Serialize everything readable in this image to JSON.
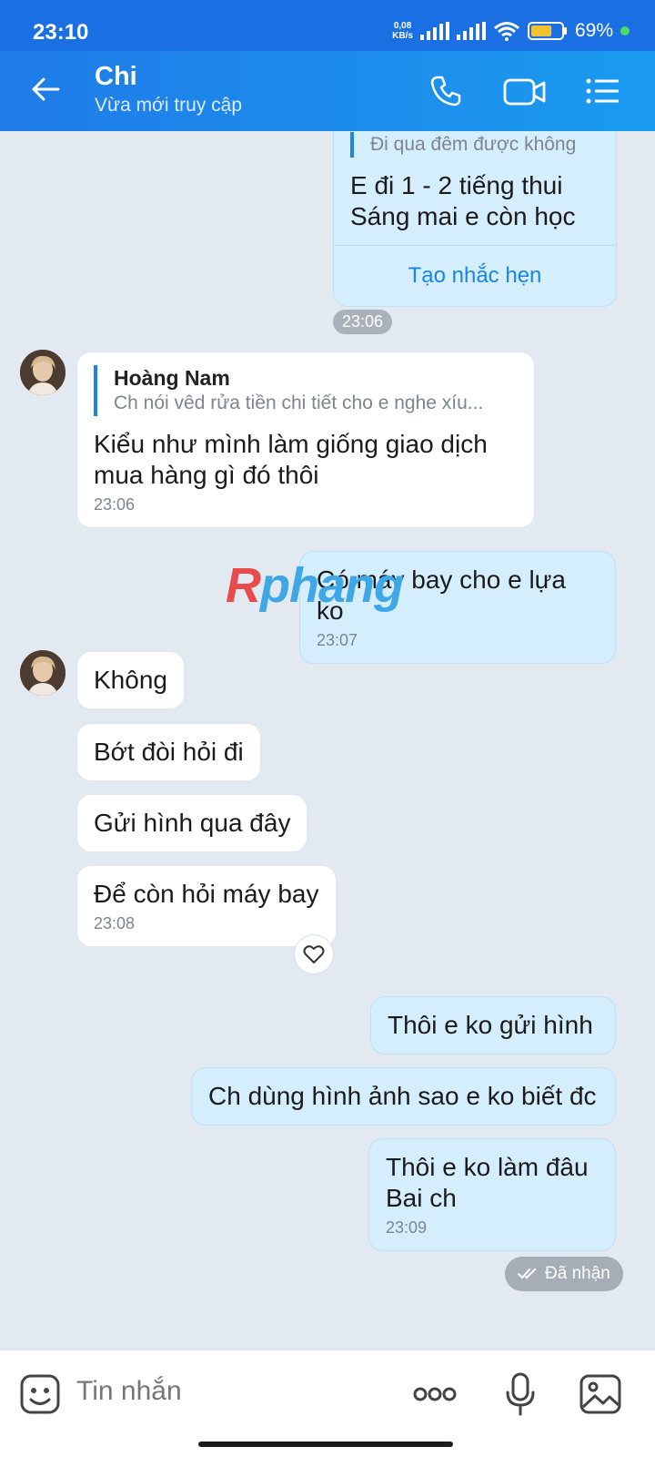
{
  "status_bar": {
    "time": "23:10",
    "net_speed_value": "0,08",
    "net_speed_unit": "KB/s",
    "battery_pct": "69%",
    "battery_level": 0.69
  },
  "header": {
    "contact_name": "Chi",
    "contact_status": "Vừa mới truy cập",
    "icons": [
      "back-arrow-icon",
      "phone-icon",
      "video-call-icon",
      "menu-icon"
    ]
  },
  "messages": {
    "m1": {
      "quote_text": "Đi qua đêm được không",
      "text_line1": "E đi 1 - 2 tiếng thui",
      "text_line2": "Sáng mai e còn học",
      "action": "Tạo nhắc hẹn"
    },
    "m1_time": "23:06",
    "m2": {
      "quote_author": "Hoàng Nam",
      "quote_text": "Ch nói vêd rửa tiền chi tiết cho e nghe xíu...",
      "text_line1": "Kiểu như mình làm giống giao dịch",
      "text_line2": "mua hàng gì đó thôi",
      "time": "23:06"
    },
    "m3": {
      "text": "Có máy bay cho e lựa ko",
      "time": "23:07"
    },
    "m4": {
      "text": "Không"
    },
    "m5": {
      "text": "Bớt đòi hỏi đi"
    },
    "m6": {
      "text": "Gửi hình qua đây"
    },
    "m7": {
      "text": "Để còn hỏi máy bay",
      "time": "23:08"
    },
    "m8": {
      "text": "Thôi e ko gửi hình"
    },
    "m9": {
      "text": "Ch dùng hình ảnh sao e ko biết đc"
    },
    "m10": {
      "text_line1": "Thôi e ko làm đâu",
      "text_line2": "Bai ch",
      "time": "23:09"
    },
    "received_label": "Đã nhận"
  },
  "watermark": {
    "part1": "R",
    "part2": "phang"
  },
  "input_bar": {
    "placeholder": "Tin nhắn",
    "icons": [
      "emoji-icon",
      "more-icon",
      "microphone-icon",
      "image-icon"
    ]
  },
  "colors": {
    "header_bg": "#1f7be8",
    "chat_bg": "#e2e9f1",
    "my_bubble": "#d5eefd",
    "their_bubble": "#ffffff",
    "accent": "#1a85e6"
  }
}
